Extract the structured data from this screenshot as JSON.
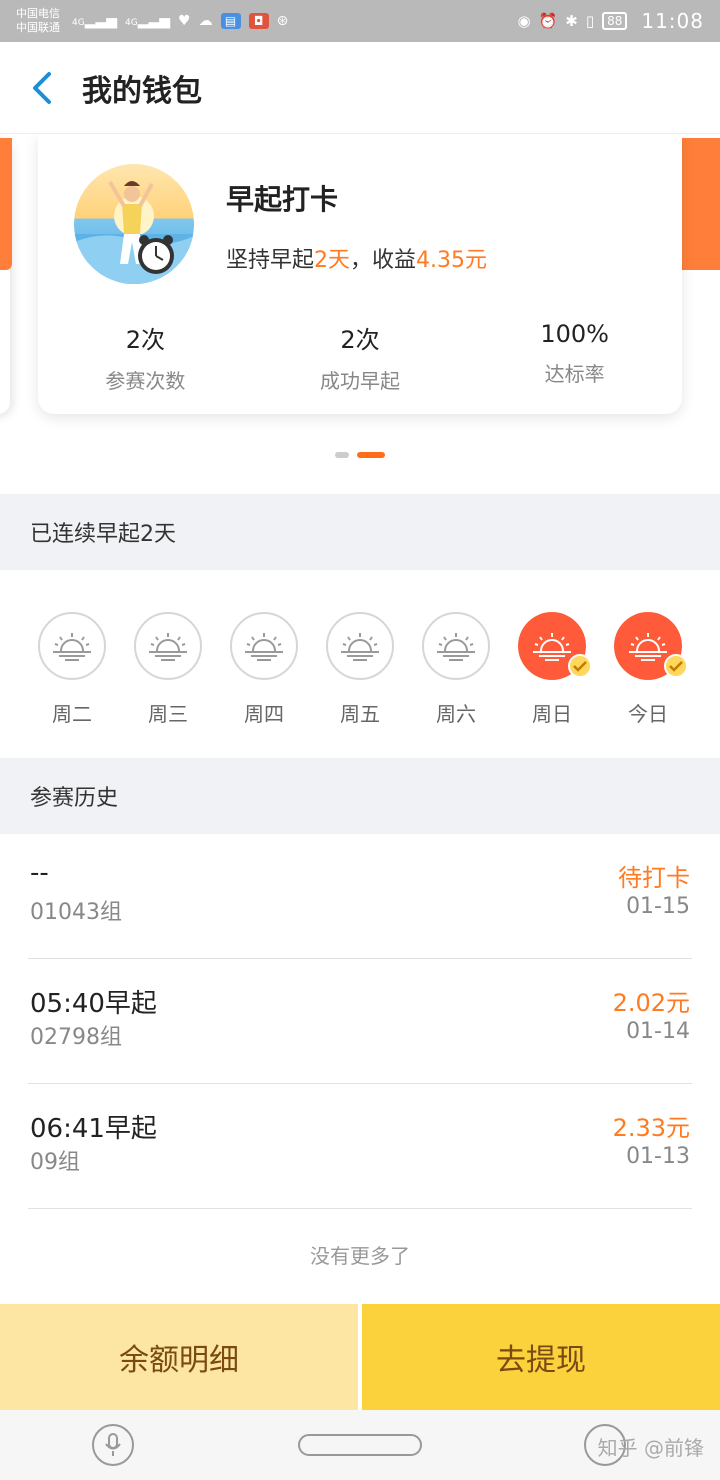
{
  "status_bar": {
    "carrier1": "中国电信",
    "carrier2": "中国联通",
    "signal1": "4G",
    "signal2": "4G",
    "battery": "88",
    "time": "11:08"
  },
  "header": {
    "title": "我的钱包"
  },
  "card": {
    "name": "早起打卡",
    "desc_prefix": "坚持早起",
    "days": "2天",
    "desc_mid": "，收益",
    "earnings": "4.35元",
    "stats": [
      {
        "value": "2次",
        "label": "参赛次数"
      },
      {
        "value": "2次",
        "label": "成功早起"
      },
      {
        "value": "100%",
        "label": "达标率"
      }
    ],
    "page_active": 2,
    "page_count": 2
  },
  "streak": {
    "title": "已连续早起2天",
    "days": [
      {
        "label": "周二",
        "done": false
      },
      {
        "label": "周三",
        "done": false
      },
      {
        "label": "周四",
        "done": false
      },
      {
        "label": "周五",
        "done": false
      },
      {
        "label": "周六",
        "done": false
      },
      {
        "label": "周日",
        "done": true
      },
      {
        "label": "今日",
        "done": true
      }
    ]
  },
  "history": {
    "title": "参赛历史",
    "rows": [
      {
        "title": "--",
        "group": "01043组",
        "status": "待打卡",
        "date": "01-15"
      },
      {
        "title": "05:40早起",
        "group": "02798组",
        "status": "2.02元",
        "date": "01-14"
      },
      {
        "title": "06:41早起",
        "group": "09组",
        "status": "2.33元",
        "date": "01-13"
      }
    ],
    "no_more": "没有更多了"
  },
  "buttons": {
    "balance": "余额明细",
    "withdraw": "去提现"
  },
  "watermark": "知乎 @前锋",
  "colors": {
    "accent": "#ff7a21",
    "done_sun": "#ff5b3a",
    "withdraw_bg": "#fbd23c",
    "balance_bg": "#fde6a4"
  }
}
